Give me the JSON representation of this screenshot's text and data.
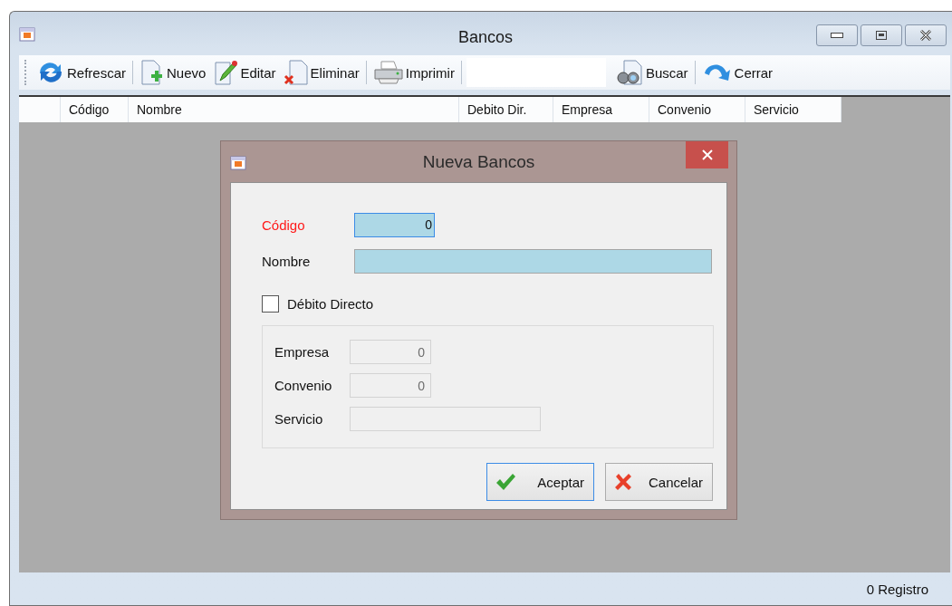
{
  "window": {
    "title": "Bancos"
  },
  "toolbar": {
    "items": [
      {
        "kind": "button",
        "label": "Refrescar"
      },
      {
        "kind": "separator"
      },
      {
        "kind": "button",
        "label": "Nuevo"
      },
      {
        "kind": "button",
        "label": "Editar"
      },
      {
        "kind": "button",
        "label": "Eliminar"
      },
      {
        "kind": "separator"
      },
      {
        "kind": "button",
        "label": "Imprimir"
      },
      {
        "kind": "separator"
      },
      {
        "kind": "search"
      },
      {
        "kind": "button",
        "label": "Buscar"
      },
      {
        "kind": "separator"
      },
      {
        "kind": "button",
        "label": "Cerrar"
      }
    ]
  },
  "grid": {
    "columns": [
      "Código",
      "Nombre",
      "Debito Dir.",
      "Empresa",
      "Convenio",
      "Servicio"
    ]
  },
  "dialog": {
    "title": "Nueva Bancos",
    "fields": [
      {
        "label": "Código",
        "value": "0",
        "required": true,
        "focused": true
      },
      {
        "label": "Nombre",
        "required": false,
        "focused": false
      }
    ],
    "checkbox": {
      "label": "Débito Directo",
      "checked": false
    },
    "group_fields": [
      {
        "label": "Empresa",
        "value": "0",
        "disabled": true
      },
      {
        "label": "Convenio",
        "value": "0",
        "disabled": true
      },
      {
        "label": "Servicio",
        "disabled": true
      }
    ],
    "buttons": [
      {
        "kind": "accept",
        "label": "Aceptar",
        "focused": true
      },
      {
        "kind": "cancel",
        "label": "Cancelar",
        "focused": false
      }
    ]
  },
  "status_bar": {
    "text": "0 Registro"
  }
}
